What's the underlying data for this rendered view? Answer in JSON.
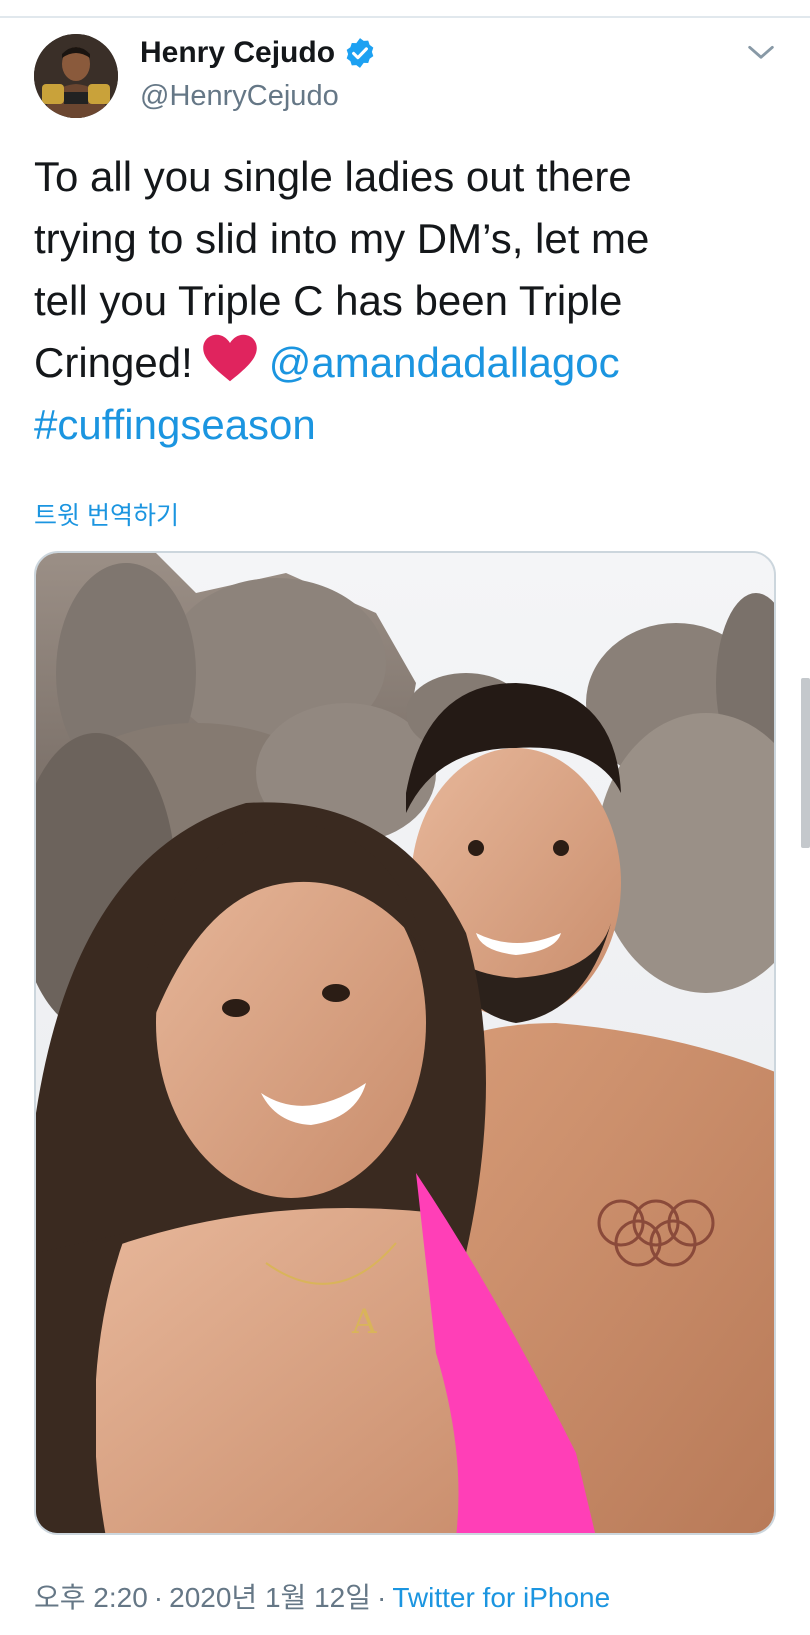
{
  "author": {
    "display_name": "Henry Cejudo",
    "handle": "@HenryCejudo",
    "verified": true,
    "avatar_icon": "avatar-photo"
  },
  "tweet": {
    "line1": "To all you single ladies out there",
    "line2": "trying to slid into my DM’s,  let me",
    "line3": "tell you Triple C has been Triple",
    "line4_prefix": "Cringed!",
    "line4_emoji": "heart-emoji",
    "line4_mention": "@amandadallagoc",
    "line5_hashtag": "#cuffingseason"
  },
  "translate_label": "트윗 번역하기",
  "media": {
    "icon": "photo-couple-selfie"
  },
  "meta": {
    "time": "오후 2:20",
    "separator1": "·",
    "date": "2020년 1월 12일",
    "separator2": "·",
    "source": "Twitter for iPhone"
  },
  "colors": {
    "link": "#1b95e0",
    "secondary_text": "#657786",
    "verified_badge": "#1da1f2",
    "heart": "#e0245e"
  }
}
